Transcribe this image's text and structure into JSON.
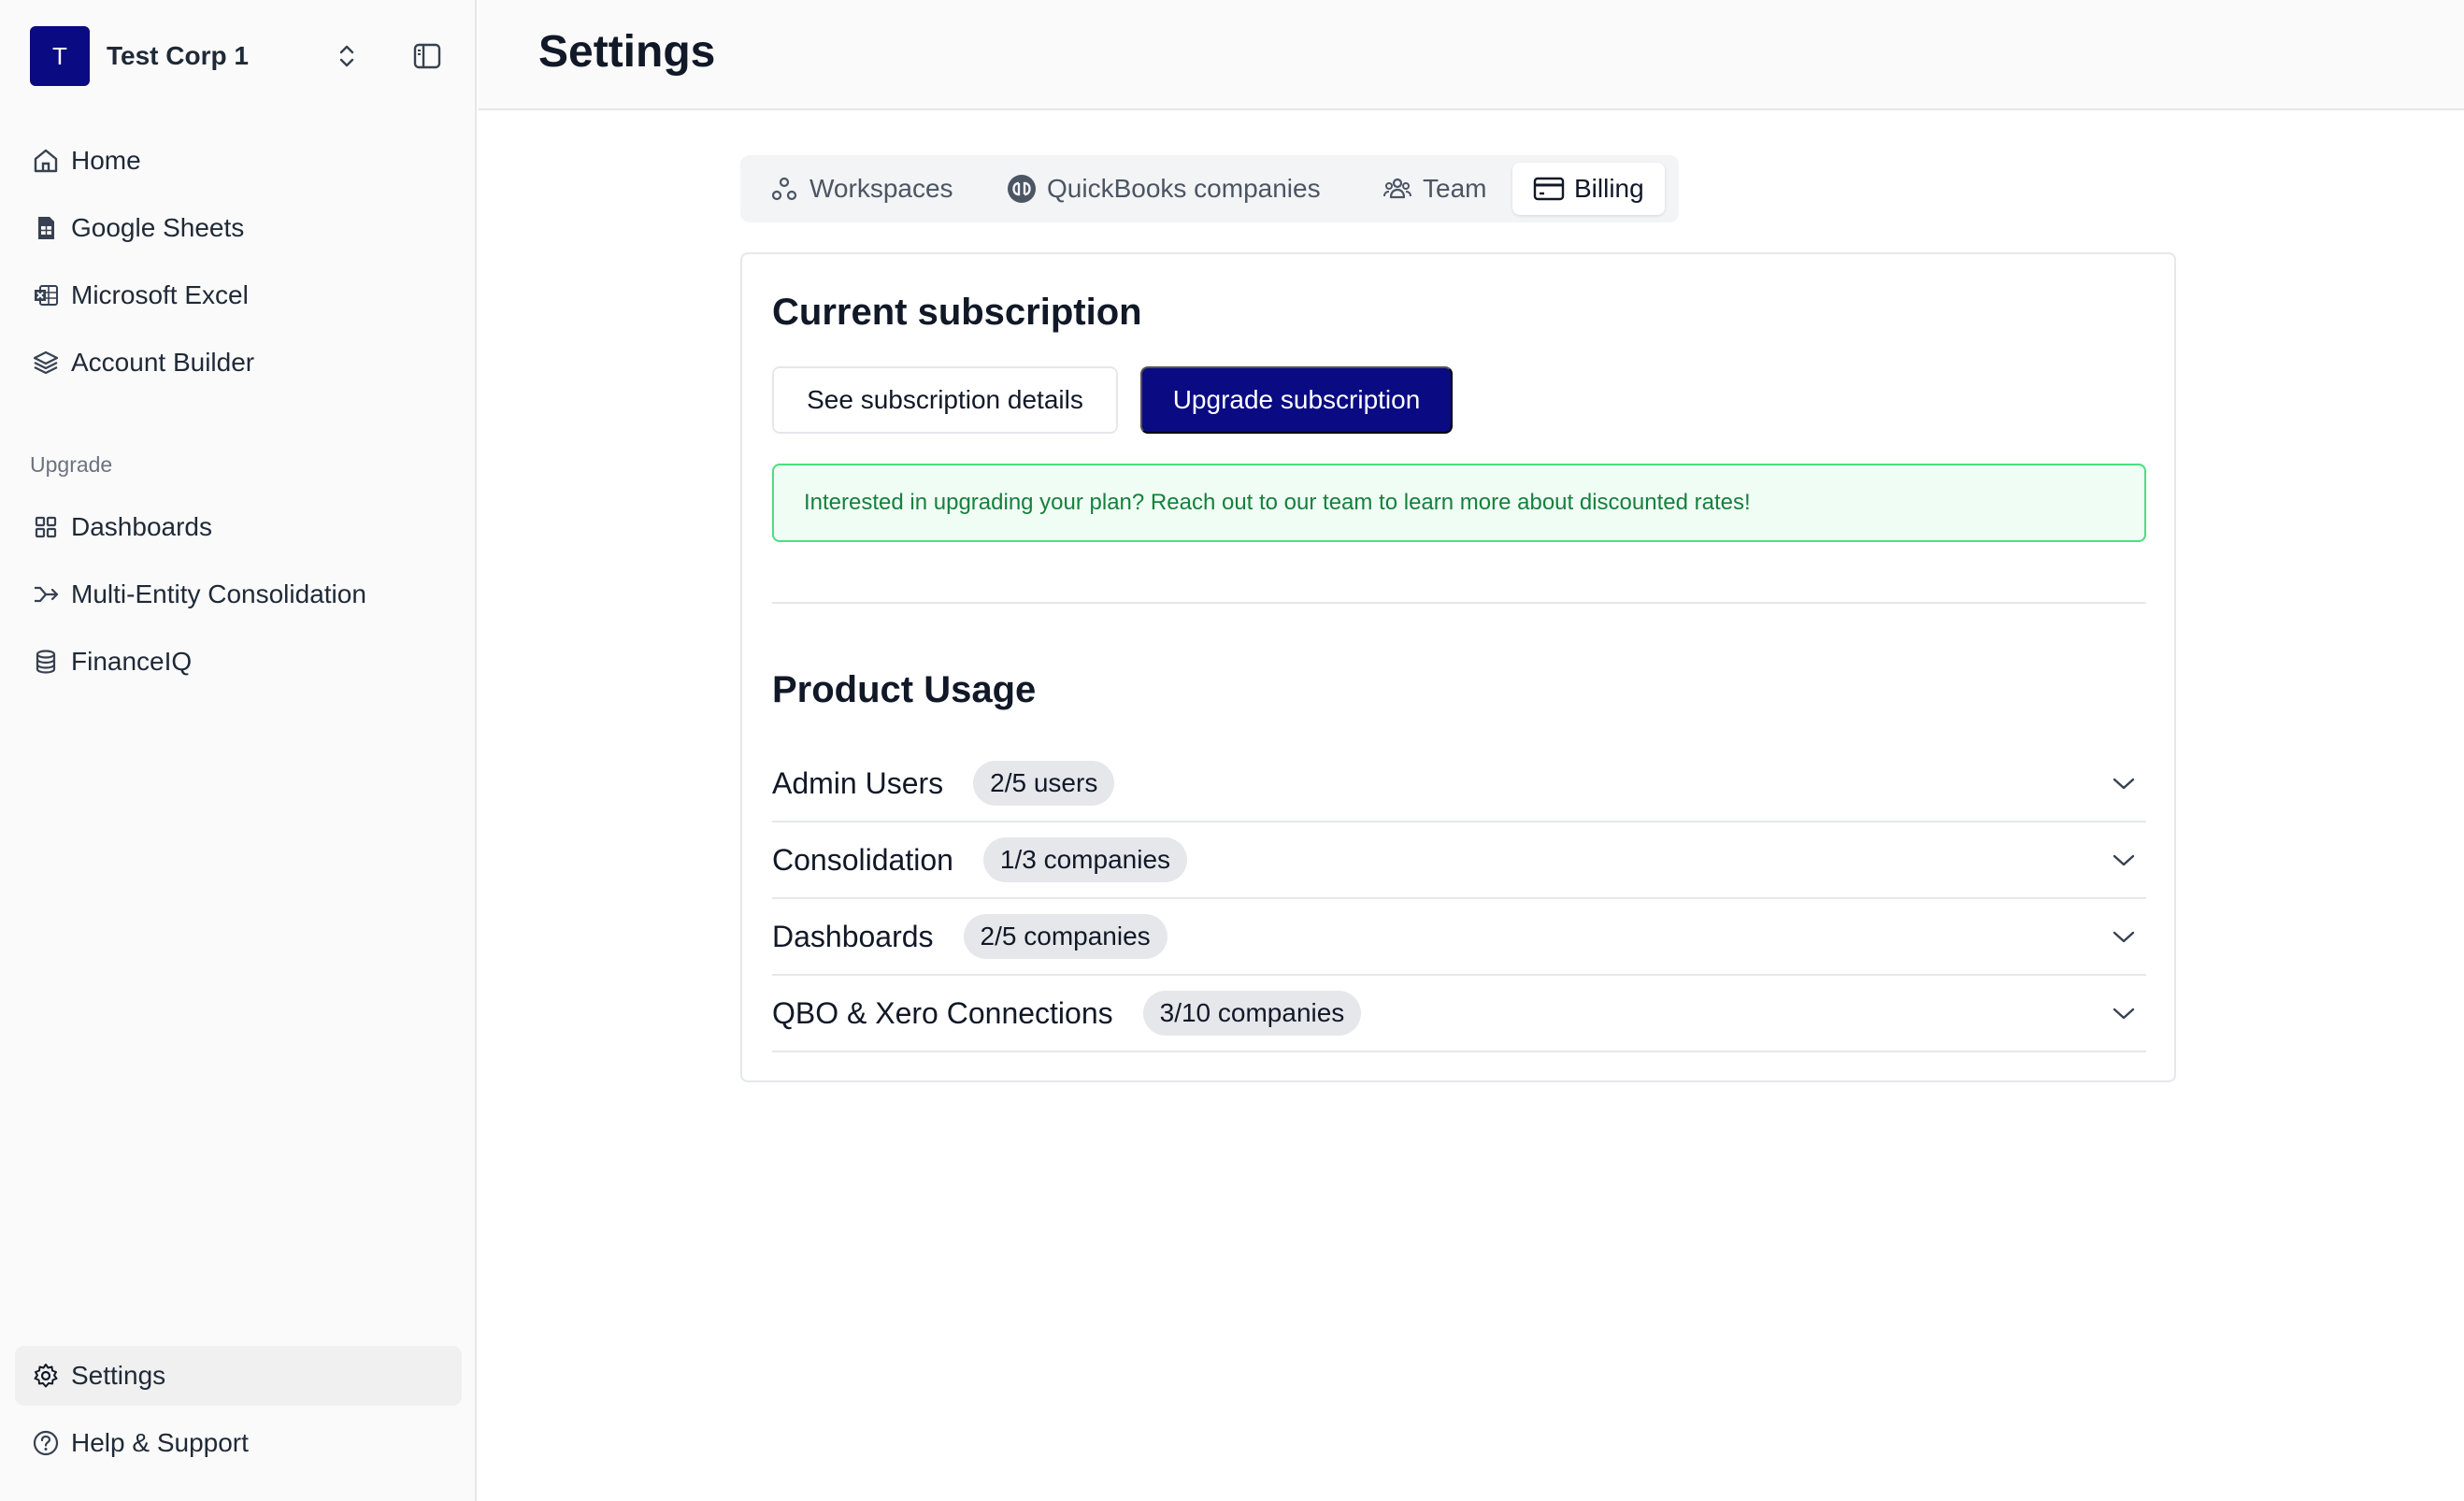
{
  "org": {
    "avatar_letter": "T",
    "name": "Test Corp 1"
  },
  "sidebar": {
    "items": [
      {
        "label": "Home",
        "icon": "home-icon"
      },
      {
        "label": "Google Sheets",
        "icon": "sheets-icon"
      },
      {
        "label": "Microsoft Excel",
        "icon": "excel-icon"
      },
      {
        "label": "Account Builder",
        "icon": "layers-icon"
      }
    ],
    "section_label": "Upgrade",
    "upgrade_items": [
      {
        "label": "Dashboards",
        "icon": "dashboard-icon"
      },
      {
        "label": "Multi-Entity Consolidation",
        "icon": "merge-icon"
      },
      {
        "label": "FinanceIQ",
        "icon": "database-icon"
      }
    ],
    "footer_items": [
      {
        "label": "Settings",
        "icon": "gear-icon",
        "active": true
      },
      {
        "label": "Help & Support",
        "icon": "help-icon"
      }
    ]
  },
  "header": {
    "title": "Settings"
  },
  "tabs": [
    {
      "label": "Workspaces",
      "icon": "workspaces-icon"
    },
    {
      "label": "QuickBooks companies",
      "icon": "quickbooks-icon"
    },
    {
      "label": "Team",
      "icon": "team-icon"
    },
    {
      "label": "Billing",
      "icon": "credit-card-icon",
      "active": true
    }
  ],
  "subscription": {
    "title": "Current subscription",
    "details_button": "See subscription details",
    "upgrade_button": "Upgrade subscription",
    "notice": "Interested in upgrading your plan? Reach out to our team to learn more about discounted rates!"
  },
  "usage": {
    "title": "Product Usage",
    "rows": [
      {
        "label": "Admin Users",
        "badge": "2/5 users"
      },
      {
        "label": "Consolidation",
        "badge": "1/3 companies"
      },
      {
        "label": "Dashboards",
        "badge": "2/5 companies"
      },
      {
        "label": "QBO & Xero Connections",
        "badge": "3/10 companies"
      }
    ]
  },
  "colors": {
    "brand": "#0a0a82",
    "notice_bg": "#f0fdf4",
    "notice_border": "#4ade80",
    "notice_text": "#15803d"
  }
}
